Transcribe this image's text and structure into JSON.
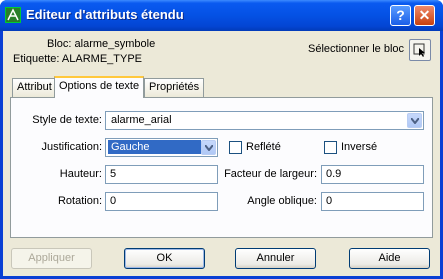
{
  "window": {
    "title": "Editeur d'attributs étendu"
  },
  "icons": {
    "app": "autocad-icon",
    "select": "pick-block-icon"
  },
  "info": {
    "block": "Bloc: alarme_symbole",
    "tag": "Etiquette: ALARME_TYPE"
  },
  "select_block": {
    "label": "Sélectionner le bloc"
  },
  "tabs": [
    {
      "label": "Attribut"
    },
    {
      "label": "Options de texte"
    },
    {
      "label": "Propriétés"
    }
  ],
  "form": {
    "text_style_label": "Style de texte:",
    "text_style_value": "alarme_arial",
    "justification_label": "Justification:",
    "justification_value": "Gauche",
    "mirrored_label": "Reflété",
    "inverted_label": "Inversé",
    "height_label": "Hauteur:",
    "height_value": "5",
    "width_factor_label": "Facteur de largeur:",
    "width_factor_value": "0.9",
    "rotation_label": "Rotation:",
    "rotation_value": "0",
    "oblique_label": "Angle oblique:",
    "oblique_value": "0"
  },
  "buttons": {
    "apply": "Appliquer",
    "ok": "OK",
    "cancel": "Annuler",
    "help": "Aide"
  }
}
